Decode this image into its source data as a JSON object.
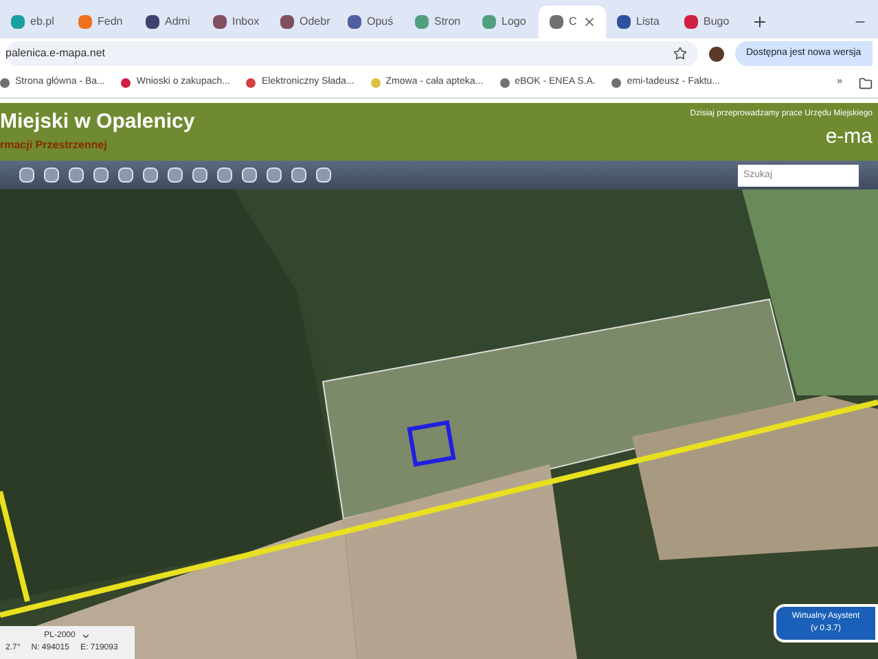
{
  "tabs": [
    {
      "label": "eb.pl",
      "color": "#1aa0a0",
      "selected": false
    },
    {
      "label": "Fedn",
      "color": "#f07020",
      "selected": false
    },
    {
      "label": "Admi",
      "color": "#404070",
      "selected": false
    },
    {
      "label": "Inbox",
      "color": "#805060",
      "selected": false
    },
    {
      "label": "Odebr",
      "color": "#805060",
      "selected": false
    },
    {
      "label": "Opuś",
      "color": "#5060a0",
      "selected": false
    },
    {
      "label": "Stron",
      "color": "#50a080",
      "selected": false
    },
    {
      "label": "Logo",
      "color": "#50a080",
      "selected": false
    },
    {
      "label": "C",
      "color": "#707070",
      "selected": true
    },
    {
      "label": "Lista",
      "color": "#3050a0",
      "selected": false
    },
    {
      "label": "Bugo",
      "color": "#d02040",
      "selected": false
    }
  ],
  "address": {
    "url": "palenica.e-mapa.net",
    "update_button": "Dostępna jest nowa wersja"
  },
  "bookmarks": [
    {
      "label": "Strona główna - Ba...",
      "color": "#707070"
    },
    {
      "label": "Wnioski o zakupach...",
      "color": "#d02040"
    },
    {
      "label": "Elektroniczny Słada...",
      "color": "#d04040"
    },
    {
      "label": "Zmowa - cała apteka...",
      "color": "#e0c040"
    },
    {
      "label": "eBOK - ENEA S.A.",
      "color": "#707070"
    },
    {
      "label": "emi-tadeusz - Faktu...",
      "color": "#707070"
    }
  ],
  "bookmarks_more": "»",
  "header": {
    "title": "Miejski w Opalenicy",
    "subtitle": "rmacji Przestrzennej",
    "notice": "Dzisiaj przeprowadzamy prace Urzędu Miejskiego",
    "brand": "e-ma"
  },
  "search": {
    "placeholder": "Szukaj"
  },
  "coordinates": {
    "system": "PL-2000",
    "left": "2.7°",
    "n": "N: 494015",
    "e": "E: 719093"
  },
  "assistant": {
    "title": "Wirtualny Asystent",
    "version": "(v 0.3.7)"
  }
}
